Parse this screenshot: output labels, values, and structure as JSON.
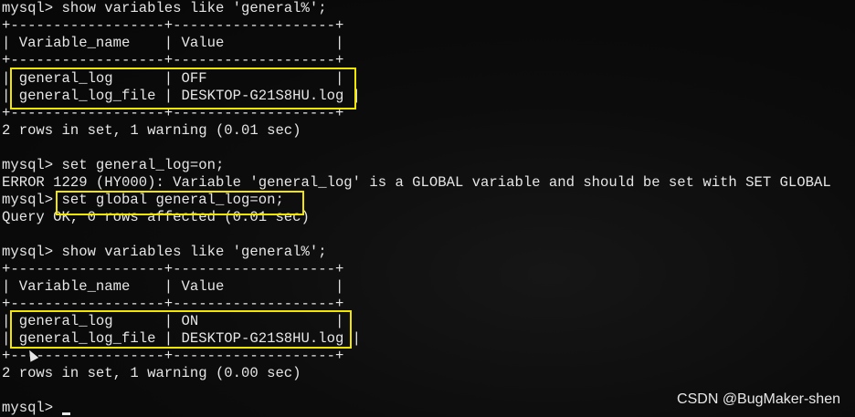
{
  "terminal": {
    "lines": [
      "mysql> show variables like 'general%';",
      "+------------------+-------------------+",
      "| Variable_name    | Value             |",
      "+------------------+-------------------+",
      "| general_log      | OFF               |",
      "| general_log_file | DESKTOP-G21S8HU.log |",
      "+------------------+-------------------+",
      "2 rows in set, 1 warning (0.01 sec)",
      "",
      "mysql> set general_log=on;",
      "ERROR 1229 (HY000): Variable 'general_log' is a GLOBAL variable and should be set with SET GLOBAL",
      "mysql> set global general_log=on;",
      "Query OK, 0 rows affected (0.01 sec)",
      "",
      "mysql> show variables like 'general%';",
      "+------------------+-------------------+",
      "| Variable_name    | Value             |",
      "+------------------+-------------------+",
      "| general_log      | ON                |",
      "| general_log_file | DESKTOP-G21S8HU.log |",
      "+------------------+-------------------+",
      "2 rows in set, 1 warning (0.00 sec)",
      "",
      "mysql> "
    ]
  },
  "watermark": "CSDN @BugMaker-shen",
  "colors": {
    "highlight": "#f2e600",
    "background": "#0b0b0b",
    "text": "#e6e6e6"
  }
}
